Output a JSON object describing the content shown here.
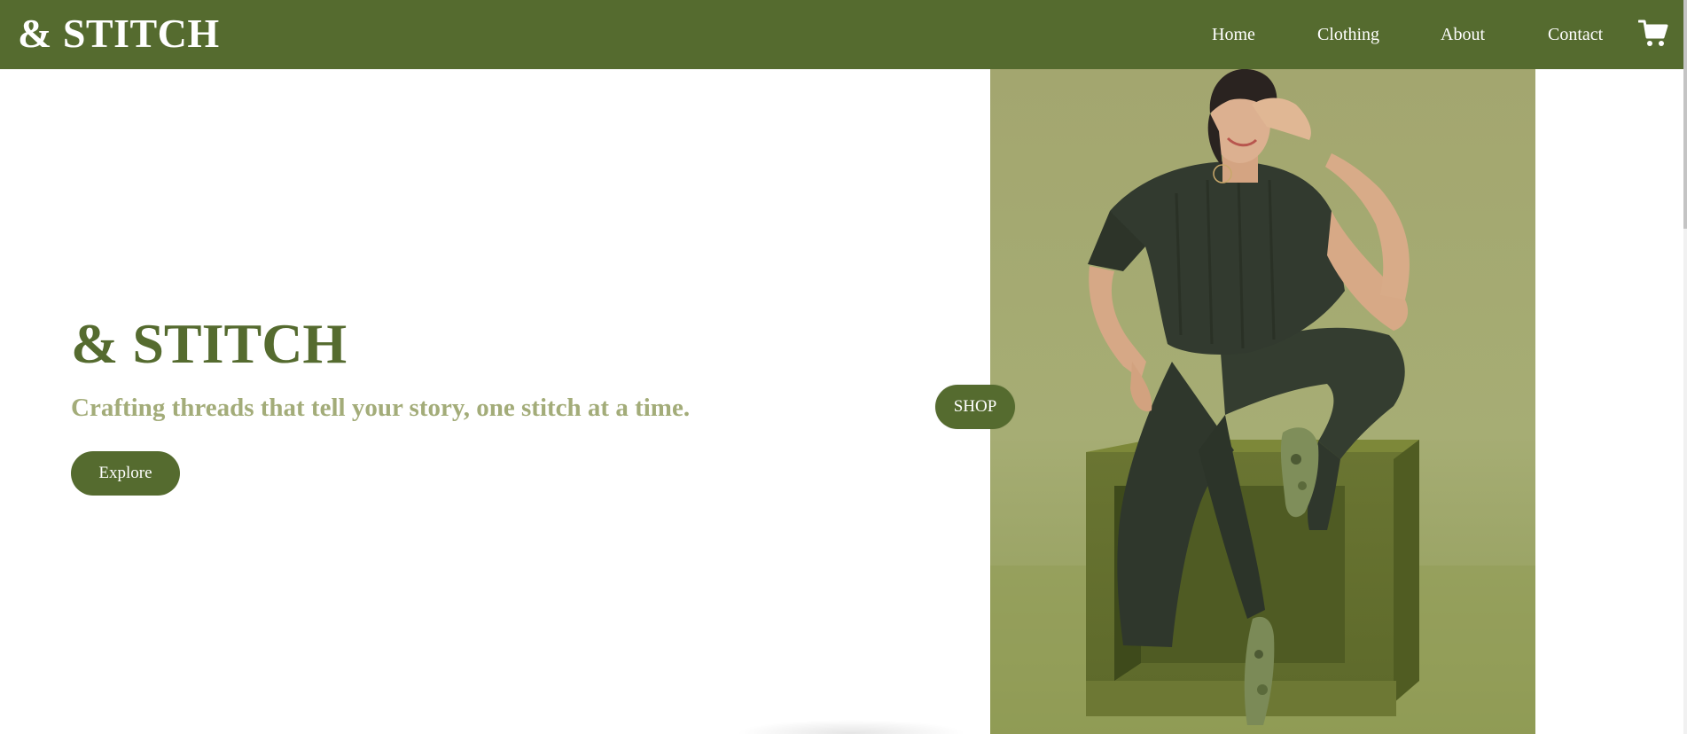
{
  "header": {
    "brand": "& STITCH",
    "nav": [
      {
        "label": "Home"
      },
      {
        "label": "Clothing"
      },
      {
        "label": "About"
      },
      {
        "label": "Contact"
      }
    ],
    "cart_icon": "shopping-cart-icon"
  },
  "hero": {
    "title": "& STITCH",
    "tagline": "Crafting threads that tell your story, one stitch at a time.",
    "explore_label": "Explore",
    "shop_label": "SHOP",
    "photo": "model-photo"
  },
  "colors": {
    "brand_green": "#556b2f",
    "tagline_green": "#a3ac79",
    "photo_backdrop": "#a2a96e",
    "outfit": "#2f372c",
    "cube": "#5f6b2e"
  }
}
